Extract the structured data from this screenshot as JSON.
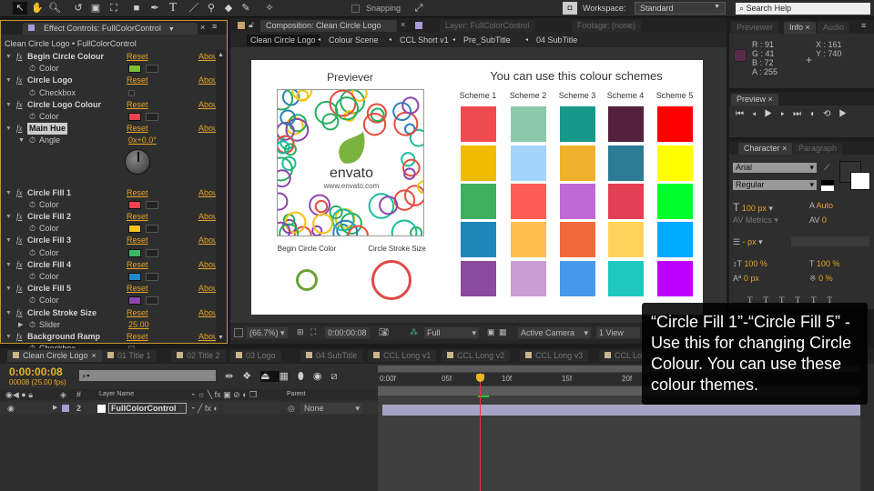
{
  "toolbar": {
    "snapping": "Snapping",
    "workspace_label": "Workspace:",
    "workspace_value": "Standard",
    "search_placeholder": "Search Help"
  },
  "effect_controls": {
    "tab": "Effect Controls: FullColorControl",
    "breadcrumb": "Clean Circle Logo • FullColorControl",
    "reset": "Reset",
    "about": "Abou",
    "rows": [
      {
        "kind": "effect",
        "name": "Begin Circle Colour"
      },
      {
        "kind": "color",
        "name": "Color",
        "color": "#7cc03a"
      },
      {
        "kind": "effect",
        "name": "Circle Logo"
      },
      {
        "kind": "checkbox",
        "name": "Checkbox"
      },
      {
        "kind": "effect",
        "name": "Circle Logo Colour"
      },
      {
        "kind": "color",
        "name": "Color",
        "color": "#f0434f"
      },
      {
        "kind": "effect",
        "name": "Main Hue",
        "selected": true
      },
      {
        "kind": "value",
        "name": "Angle",
        "value": "0x+0.0°"
      },
      {
        "kind": "dial"
      },
      {
        "kind": "effect",
        "name": "Circle Fill 1"
      },
      {
        "kind": "color",
        "name": "Color",
        "color": "#f0434f"
      },
      {
        "kind": "effect",
        "name": "Circle Fill 2"
      },
      {
        "kind": "color",
        "name": "Color",
        "color": "#f5c21c"
      },
      {
        "kind": "effect",
        "name": "Circle Fill 3"
      },
      {
        "kind": "color",
        "name": "Color",
        "color": "#3cb765"
      },
      {
        "kind": "effect",
        "name": "Circle Fill 4"
      },
      {
        "kind": "color",
        "name": "Color",
        "color": "#2287c9"
      },
      {
        "kind": "effect",
        "name": "Circle Fill 5"
      },
      {
        "kind": "color",
        "name": "Color",
        "color": "#8e44ad"
      },
      {
        "kind": "effect",
        "name": "Circle Stroke Size"
      },
      {
        "kind": "value",
        "name": "Slider",
        "value": "25.00"
      },
      {
        "kind": "effect",
        "name": "Background Ramp"
      },
      {
        "kind": "checkbox",
        "name": "Checkbox"
      }
    ]
  },
  "composition": {
    "tab": "Composition: Clean Circle Logo",
    "layer_tab": "Layer: FullColorControl",
    "footage_tab": "Footage: (none)",
    "breadcrumbs": [
      "Clean Circle Logo",
      "Colour Scene",
      "CCL Short v1",
      "Pre_SubTitle",
      "04 SubTitle"
    ],
    "previewer_title": "Previever",
    "logo_text": "envato",
    "logo_url": "www.envato.com",
    "begin_circle_label": "Begin Circle Color",
    "stroke_size_label": "Circle Stroke Size",
    "schemes_title": "You can use this colour schemes",
    "schemes": [
      {
        "name": "Scheme 1",
        "colors": [
          "#ef4a4f",
          "#f0bc00",
          "#3daf5e",
          "#1f87b9",
          "#8a4a9e"
        ]
      },
      {
        "name": "Scheme 2",
        "colors": [
          "#8cc8ab",
          "#a4d4fb",
          "#fc5c55",
          "#fcbf50",
          "#c99cd4"
        ]
      },
      {
        "name": "Scheme 3",
        "colors": [
          "#17998a",
          "#f0b22c",
          "#bf69d5",
          "#f06a3c",
          "#4797ea"
        ]
      },
      {
        "name": "Scheme 4",
        "colors": [
          "#54213c",
          "#2e7b95",
          "#e23f55",
          "#ffd25c",
          "#1ec8c0"
        ]
      },
      {
        "name": "Scheme 5",
        "colors": [
          "#ff0000",
          "#ffff00",
          "#00ff2e",
          "#00aaff",
          "#bb00ff"
        ]
      }
    ],
    "zoom": "(66.7%)",
    "timecode": "0:00:00:08",
    "resolution": "Full",
    "camera": "Active Camera",
    "views": "1 View"
  },
  "info": {
    "tabs": [
      "Previewer",
      "Info",
      "Audio"
    ],
    "r": "R : 91",
    "g": "G : 41",
    "b": "B : 72",
    "a": "A : 255",
    "x": "X : 161",
    "y": "Y : 740",
    "sample_color": "#5b2948"
  },
  "preview": {
    "tab": "Preview"
  },
  "character": {
    "tabs": [
      "Character",
      "Paragraph"
    ],
    "font": "Arial",
    "style": "Regular",
    "size": "100 px",
    "leading": "Auto",
    "kerning": "Metrics",
    "tracking": "0",
    "stroke": "- px",
    "vscale": "100 %",
    "hscale": "100 %",
    "baseline": "0 px",
    "tsume": "0 %"
  },
  "timeline": {
    "tabs": [
      "Clean Circle Logo",
      "01 Title 1",
      "02 Title 2",
      "03 Logo",
      "04 SubTitle",
      "CCL Long v1",
      "CCL Long v2",
      "CCL Long v3",
      "CCL Long"
    ],
    "timecode": "0:00:00:08",
    "frames": "00008 (25.00 fps)",
    "col_layer_name": "Layer Name",
    "col_parent": "Parent",
    "col_num": "#",
    "layer": {
      "num": "2",
      "name": "FullColorControl",
      "parent": "None"
    },
    "ruler": [
      "0:00f",
      "05f",
      "10f",
      "15f",
      "20f"
    ]
  },
  "caption": "“Circle Fill 1”-“Circle Fill 5” - Use this for changing Circle Colour. You can use these colour themes."
}
